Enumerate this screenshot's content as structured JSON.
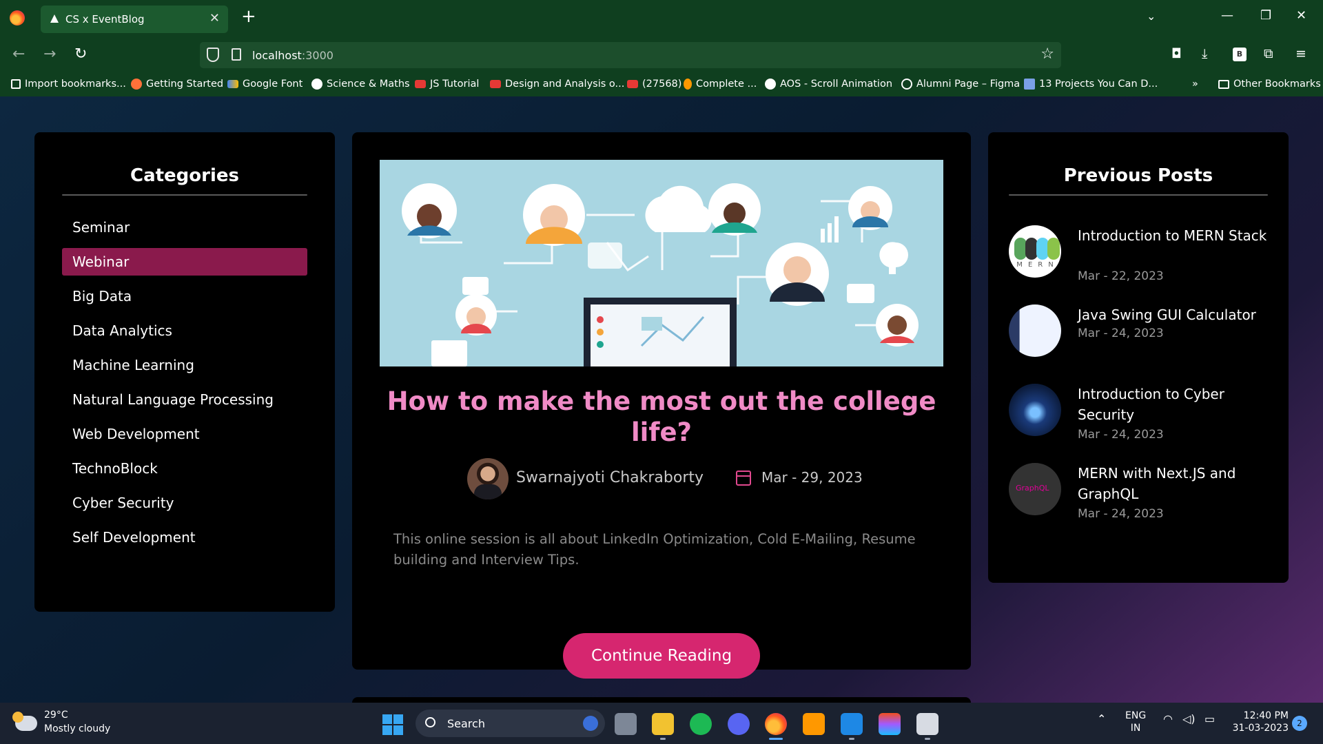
{
  "browser": {
    "tab_title": "CS x EventBlog",
    "url_host": "localhost",
    "url_port": ":3000",
    "bookmarks": [
      {
        "label": "Import bookmarks...",
        "icon": "import-icon"
      },
      {
        "label": "Getting Started",
        "icon": "firefox-icon"
      },
      {
        "label": "Google Font",
        "icon": "google-fonts-icon"
      },
      {
        "label": "Science & Maths",
        "icon": "site-icon"
      },
      {
        "label": "JS Tutorial",
        "icon": "youtube-icon"
      },
      {
        "label": "Design and Analysis o...",
        "icon": "youtube-icon"
      },
      {
        "label": "(27568)",
        "icon": "youtube-icon"
      },
      {
        "label": "Complete ...",
        "icon": "fire-icon"
      },
      {
        "label": "AOS - Scroll Animation",
        "icon": "github-icon"
      },
      {
        "label": "Alumni Page – Figma",
        "icon": "globe-icon"
      },
      {
        "label": "13 Projects You Can D...",
        "icon": "profile-icon"
      }
    ],
    "other_bookmarks": "Other Bookmarks"
  },
  "sidebar": {
    "title": "Categories",
    "items": [
      {
        "label": "Seminar",
        "active": false
      },
      {
        "label": "Webinar",
        "active": true
      },
      {
        "label": "Big Data",
        "active": false
      },
      {
        "label": "Data Analytics",
        "active": false
      },
      {
        "label": "Machine Learning",
        "active": false
      },
      {
        "label": "Natural Language Processing",
        "active": false
      },
      {
        "label": "Web Development",
        "active": false
      },
      {
        "label": "TechnoBlock",
        "active": false
      },
      {
        "label": "Cyber Security",
        "active": false
      },
      {
        "label": "Self Development",
        "active": false
      }
    ]
  },
  "post": {
    "title": "How to make the most out the college life?",
    "author": "Swarnajyoti Chakraborty",
    "date": "Mar - 29, 2023",
    "excerpt": "This online session is all about LinkedIn Optimization, Cold E-Mailing, Resume building and Interview Tips.",
    "cta": "Continue Reading"
  },
  "previous": {
    "title": "Previous Posts",
    "items": [
      {
        "title": "Introduction to MERN Stack",
        "date": "Mar - 22, 2023"
      },
      {
        "title": "Java Swing GUI Calculator",
        "date": "Mar - 24, 2023"
      },
      {
        "title": "Introduction to Cyber Security",
        "date": "Mar - 24, 2023"
      },
      {
        "title": "MERN with Next.JS and GraphQL",
        "date": "Mar - 24, 2023"
      }
    ],
    "graphql_label": "GraphQL",
    "mern_letters": [
      "M",
      "E",
      "R",
      "N"
    ]
  },
  "taskbar": {
    "temperature": "29°C",
    "weather": "Mostly cloudy",
    "search": "Search",
    "lang1": "ENG",
    "lang2": "IN",
    "time": "12:40 PM",
    "date": "31-03-2023",
    "notifications": "2"
  },
  "colors": {
    "accent": "#d6266f",
    "title_pink": "#f08bc6",
    "active_category": "#8a1a4c"
  }
}
